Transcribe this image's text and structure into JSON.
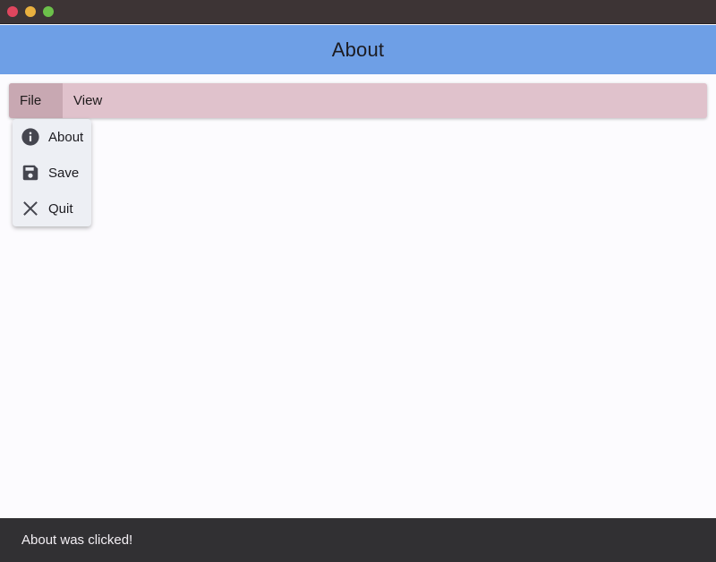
{
  "colors": {
    "titlebar": "#3d3435",
    "traffic_close": "#e0465e",
    "traffic_minimize": "#e9b03f",
    "traffic_maximize": "#6cc04a",
    "appbar_bg": "#6e9fe6",
    "menubar_bg": "#e0c2cc",
    "menubar_active_bg": "#c8a8b2",
    "menu_bg": "#edeff4",
    "icon": "#45464f",
    "snackbar_bg": "#313033"
  },
  "appbar": {
    "title": "About"
  },
  "menubar": {
    "items": [
      {
        "label": "File",
        "active": true
      },
      {
        "label": "View",
        "active": false
      }
    ]
  },
  "file_menu": {
    "items": [
      {
        "label": "About",
        "icon": "info-icon"
      },
      {
        "label": "Save",
        "icon": "save-icon"
      },
      {
        "label": "Quit",
        "icon": "close-icon"
      }
    ]
  },
  "snackbar": {
    "message": "About was clicked!"
  }
}
